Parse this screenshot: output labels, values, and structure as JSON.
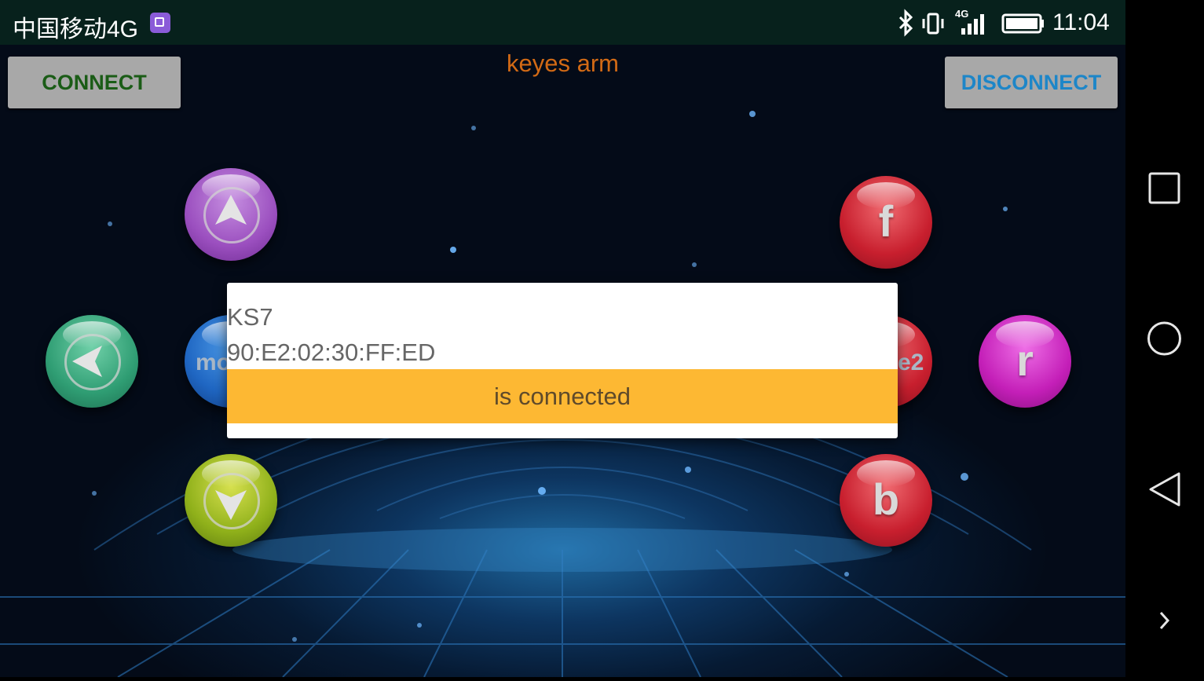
{
  "status_bar": {
    "carrier": "中国移动4G",
    "network_label": "4G",
    "time": "11:04"
  },
  "header": {
    "title": "keyes arm",
    "connect_label": "CONNECT",
    "disconnect_label": "DISCONNECT"
  },
  "controls": {
    "up": {
      "icon": "arrow-up-icon"
    },
    "left": {
      "icon": "arrow-left-icon"
    },
    "down": {
      "icon": "arrow-down-icon"
    },
    "mode_partial": "mo",
    "f": "f",
    "e2_partial": "e2",
    "r": "r",
    "b": "b"
  },
  "dialog": {
    "device_name": "KS7",
    "device_address": "90:E2:02:30:FF:ED",
    "status_text": "is connected"
  },
  "colors": {
    "title": "#d26a15",
    "connect_text": "#1a5c16",
    "disconnect_text": "#1d86c8",
    "toast_bar": "#fdb833"
  }
}
